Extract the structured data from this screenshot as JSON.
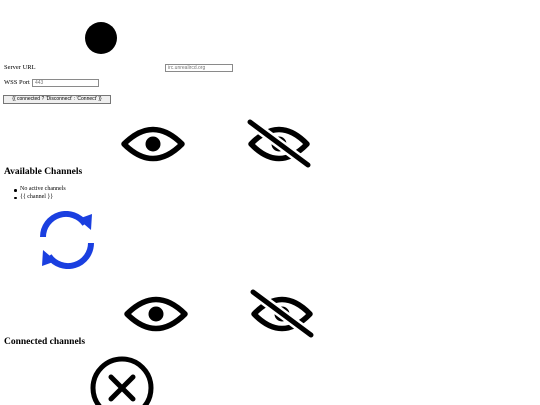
{
  "status": {
    "dot_color": "#000000",
    "icon": "status-dot-icon"
  },
  "server": {
    "url_label": "Server URL",
    "url_placeholder": "irc.unrealircd.org",
    "port_label": "WSS Port",
    "port_placeholder": "443",
    "connect_button": "{{ connected ? 'Disconnect' : 'Connect' }}"
  },
  "available": {
    "title": "Available Channels",
    "items": [
      "No active channels",
      "{{ channel }}"
    ],
    "show_icon": "eye-icon",
    "hide_icon": "eye-off-icon",
    "refresh_icon": "refresh-icon",
    "refresh_color": "#1a3fe0"
  },
  "connected": {
    "title": "Connected channels",
    "show_icon": "eye-icon",
    "hide_icon": "eye-off-icon",
    "close_icon": "close-circle-icon"
  }
}
